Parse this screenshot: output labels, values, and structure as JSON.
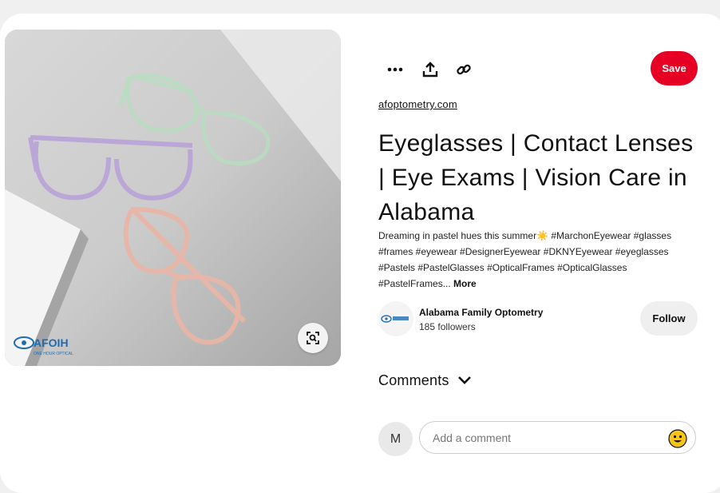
{
  "pin": {
    "image_alt": "Pastel eyeglass frames on a white surface",
    "brand_watermark": "AFOIH",
    "brand_watermark_sub": "ONE HOUR OPTICAL"
  },
  "toolbar": {
    "more_icon": "ellipsis-icon",
    "share_icon": "share-icon",
    "link_icon": "link-icon",
    "save_label": "Save",
    "save_color": "#e60023"
  },
  "source_link": "afoptometry.com",
  "title": "Eyeglasses | Contact Lenses | Eye Exams | Vision Care in Alabama",
  "description": {
    "text": "Dreaming in pastel hues this summer☀️ #MarchonEyewear #glasses #frames #eyewear #DesignerEyewear #DKNYEyewear #eyeglasses #Pastels #PastelGlasses #OpticalFrames #OpticalGlasses #PastelFrames...",
    "more": "More"
  },
  "creator": {
    "name": "Alabama Family Optometry",
    "followers": "185 followers",
    "follow_label": "Follow"
  },
  "comments": {
    "label": "Comments",
    "user_initial": "M",
    "placeholder": "Add a comment"
  }
}
